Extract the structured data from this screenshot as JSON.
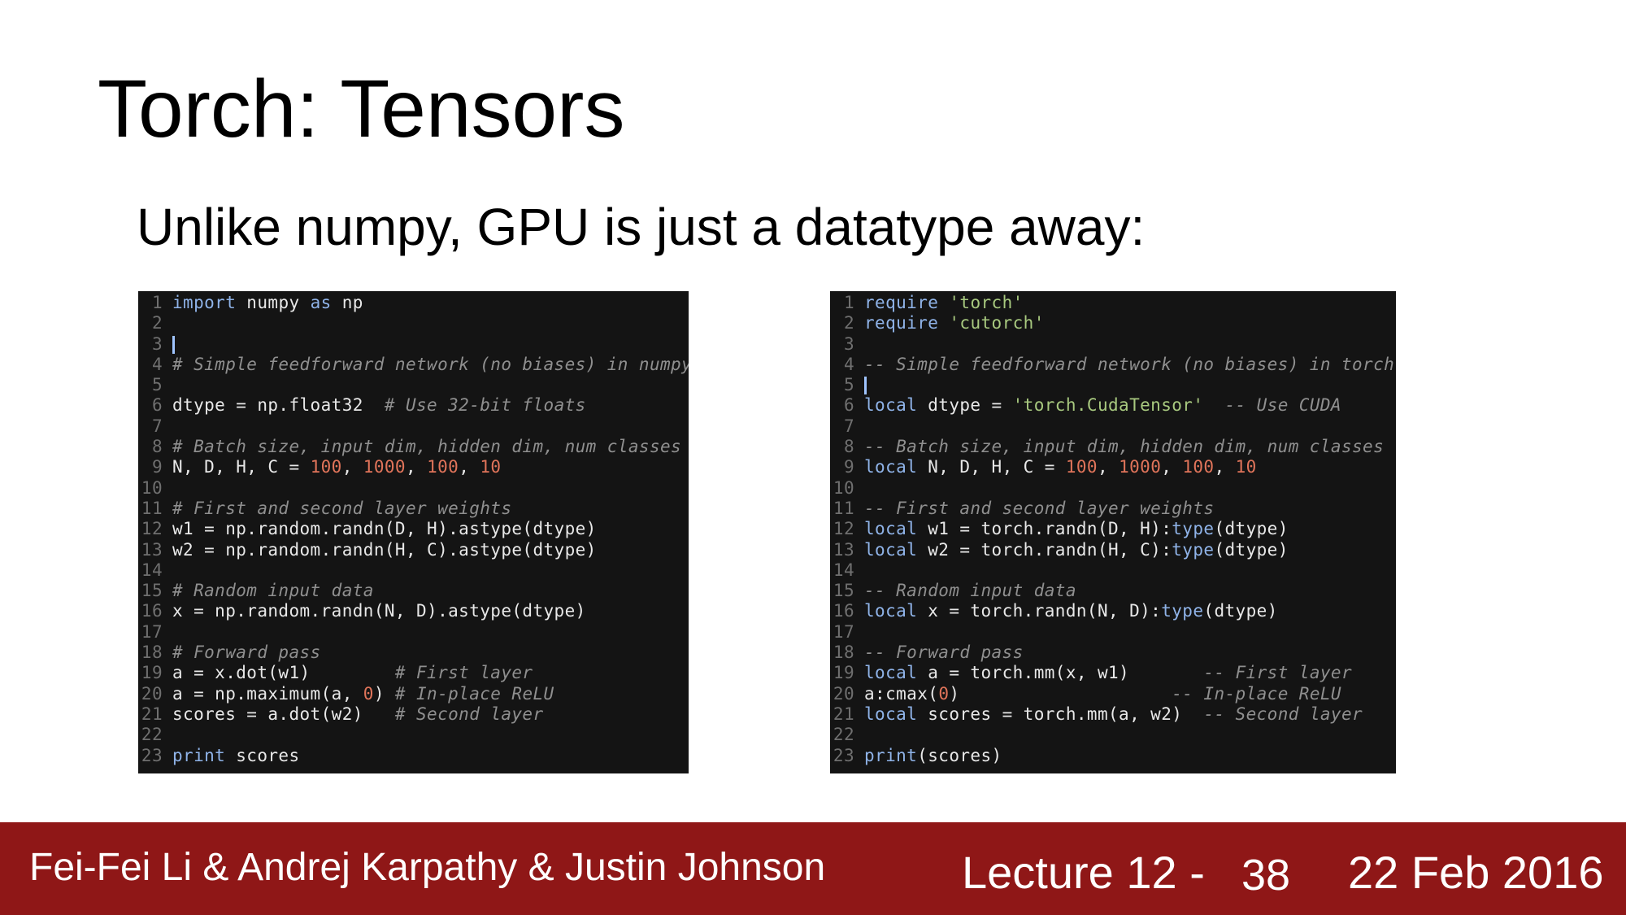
{
  "slide": {
    "title": "Torch: Tensors",
    "subtitle": "Unlike numpy, GPU is just a datatype away:"
  },
  "left_code": {
    "language": "python",
    "lines": [
      [
        [
          "kw",
          "import"
        ],
        [
          "pl",
          " numpy "
        ],
        [
          "kw",
          "as"
        ],
        [
          "pl",
          " np"
        ]
      ],
      [],
      [
        [
          "cursor",
          ""
        ]
      ],
      [
        [
          "cm",
          "# Simple feedforward network (no biases) in numpy"
        ]
      ],
      [],
      [
        [
          "pl",
          "dtype = np.float32  "
        ],
        [
          "cm",
          "# Use 32-bit floats"
        ]
      ],
      [],
      [
        [
          "cm",
          "# Batch size, input dim, hidden dim, num classes"
        ]
      ],
      [
        [
          "pl",
          "N, D, H, C = "
        ],
        [
          "nu",
          "100"
        ],
        [
          "pl",
          ", "
        ],
        [
          "nu",
          "1000"
        ],
        [
          "pl",
          ", "
        ],
        [
          "nu",
          "100"
        ],
        [
          "pl",
          ", "
        ],
        [
          "nu",
          "10"
        ]
      ],
      [],
      [
        [
          "cm",
          "# First and second layer weights"
        ]
      ],
      [
        [
          "pl",
          "w1 = np.random.randn(D, H).astype(dtype)"
        ]
      ],
      [
        [
          "pl",
          "w2 = np.random.randn(H, C).astype(dtype)"
        ]
      ],
      [],
      [
        [
          "cm",
          "# Random input data"
        ]
      ],
      [
        [
          "pl",
          "x = np.random.randn(N, D).astype(dtype)"
        ]
      ],
      [],
      [
        [
          "cm",
          "# Forward pass"
        ]
      ],
      [
        [
          "pl",
          "a = x.dot(w1)        "
        ],
        [
          "cm",
          "# First layer"
        ]
      ],
      [
        [
          "pl",
          "a = np.maximum(a, "
        ],
        [
          "nu",
          "0"
        ],
        [
          "pl",
          ") "
        ],
        [
          "cm",
          "# In-place ReLU"
        ]
      ],
      [
        [
          "pl",
          "scores = a.dot(w2)   "
        ],
        [
          "cm",
          "# Second layer"
        ]
      ],
      [],
      [
        [
          "kw",
          "print"
        ],
        [
          "pl",
          " scores"
        ]
      ]
    ]
  },
  "right_code": {
    "language": "lua",
    "lines": [
      [
        [
          "kw",
          "require"
        ],
        [
          "pl",
          " "
        ],
        [
          "st",
          "'torch'"
        ]
      ],
      [
        [
          "kw",
          "require"
        ],
        [
          "pl",
          " "
        ],
        [
          "st",
          "'cutorch'"
        ]
      ],
      [],
      [
        [
          "cm",
          "-- Simple feedforward network (no biases) in torch"
        ]
      ],
      [
        [
          "cursor",
          ""
        ]
      ],
      [
        [
          "kw",
          "local"
        ],
        [
          "pl",
          " dtype = "
        ],
        [
          "st",
          "'torch.CudaTensor'"
        ],
        [
          "pl",
          "  "
        ],
        [
          "cm",
          "-- Use CUDA"
        ]
      ],
      [],
      [
        [
          "cm",
          "-- Batch size, input dim, hidden dim, num classes"
        ]
      ],
      [
        [
          "kw",
          "local"
        ],
        [
          "pl",
          " N, D, H, C = "
        ],
        [
          "nu",
          "100"
        ],
        [
          "pl",
          ", "
        ],
        [
          "nu",
          "1000"
        ],
        [
          "pl",
          ", "
        ],
        [
          "nu",
          "100"
        ],
        [
          "pl",
          ", "
        ],
        [
          "nu",
          "10"
        ]
      ],
      [],
      [
        [
          "cm",
          "-- First and second layer weights"
        ]
      ],
      [
        [
          "kw",
          "local"
        ],
        [
          "pl",
          " w1 = torch.randn(D, H):"
        ],
        [
          "kw",
          "type"
        ],
        [
          "pl",
          "(dtype)"
        ]
      ],
      [
        [
          "kw",
          "local"
        ],
        [
          "pl",
          " w2 = torch.randn(H, C):"
        ],
        [
          "kw",
          "type"
        ],
        [
          "pl",
          "(dtype)"
        ]
      ],
      [],
      [
        [
          "cm",
          "-- Random input data"
        ]
      ],
      [
        [
          "kw",
          "local"
        ],
        [
          "pl",
          " x = torch.randn(N, D):"
        ],
        [
          "kw",
          "type"
        ],
        [
          "pl",
          "(dtype)"
        ]
      ],
      [],
      [
        [
          "cm",
          "-- Forward pass"
        ]
      ],
      [
        [
          "kw",
          "local"
        ],
        [
          "pl",
          " a = torch.mm(x, w1)       "
        ],
        [
          "cm",
          "-- First layer"
        ]
      ],
      [
        [
          "pl",
          "a:cmax("
        ],
        [
          "nu",
          "0"
        ],
        [
          "pl",
          ")                    "
        ],
        [
          "cm",
          "-- In-place ReLU"
        ]
      ],
      [
        [
          "kw",
          "local"
        ],
        [
          "pl",
          " scores = torch.mm(a, w2)  "
        ],
        [
          "cm",
          "-- Second layer"
        ]
      ],
      [],
      [
        [
          "kw",
          "print"
        ],
        [
          "pl",
          "(scores)"
        ]
      ]
    ]
  },
  "footer": {
    "authors": "Fei-Fei Li & Andrej Karpathy & Justin Johnson",
    "lecture": "Lecture 12 -",
    "page": "38",
    "date": "22 Feb 2016"
  },
  "colors": {
    "footer_bg": "#8f1717",
    "code_bg": "#141414",
    "keyword": "#8fb3e8",
    "comment": "#8f8f8f",
    "string": "#a8c97f",
    "number": "#e0745a"
  }
}
